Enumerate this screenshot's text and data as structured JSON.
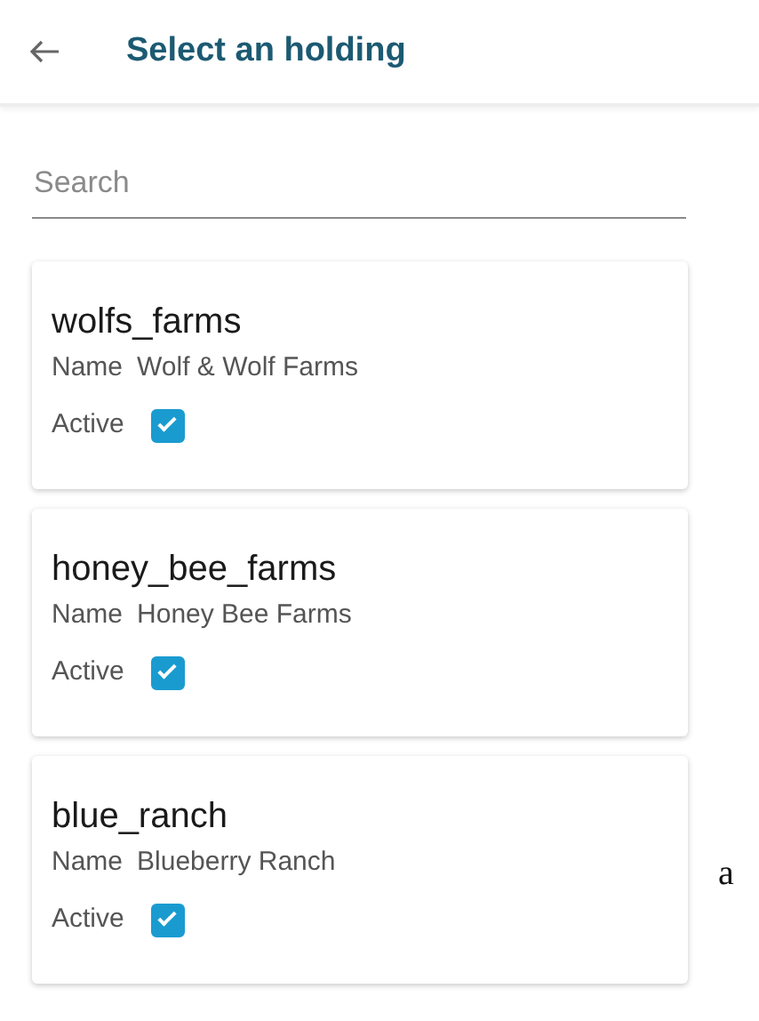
{
  "header": {
    "title": "Select an holding"
  },
  "search": {
    "placeholder": "Search"
  },
  "holdings": [
    {
      "code": "wolfs_farms",
      "name_label": "Name",
      "name": "Wolf & Wolf Farms",
      "active_label": "Active",
      "checked": true
    },
    {
      "code": "honey_bee_farms",
      "name_label": "Name",
      "name": "Honey Bee Farms",
      "active_label": "Active",
      "checked": true
    },
    {
      "code": "blue_ranch",
      "name_label": "Name",
      "name": "Blueberry Ranch",
      "active_label": "Active",
      "checked": true
    }
  ],
  "margin_note": "a"
}
